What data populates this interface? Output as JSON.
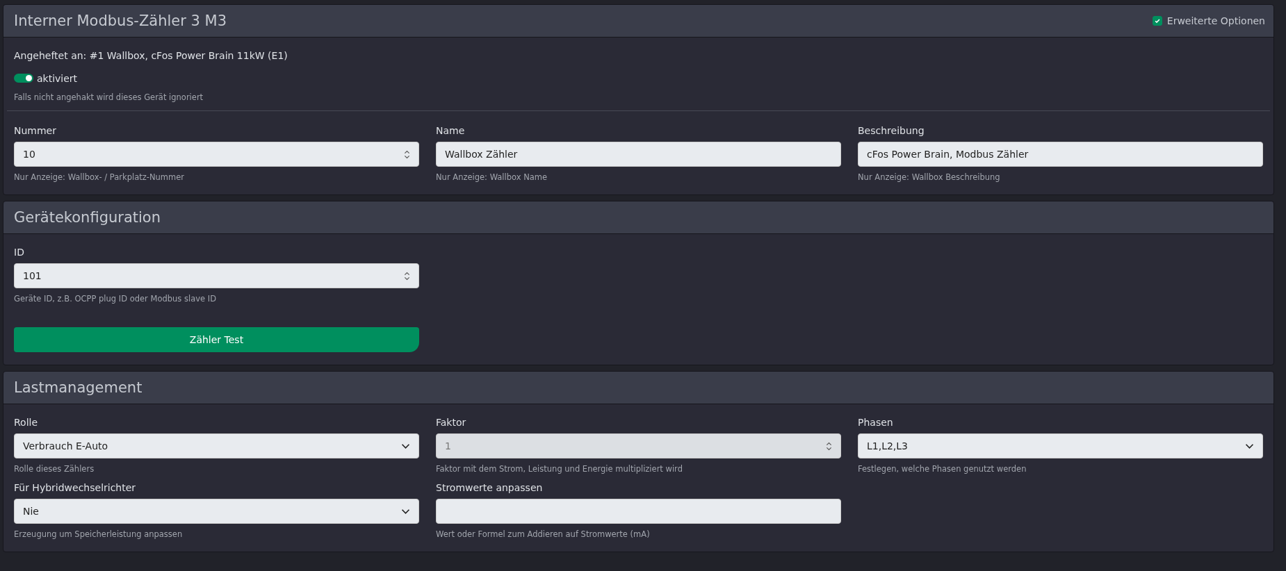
{
  "device_panel": {
    "title": "Interner Modbus-Zähler 3 M3",
    "advanced_option": {
      "label": "Erweiterte Optionen",
      "checked": true
    },
    "attached": "Angeheftet an: #1 Wallbox, cFos Power Brain 11kW (E1)",
    "enable_switch": {
      "label": "aktiviert",
      "on": true
    },
    "enable_help": "Falls nicht angehakt wird dieses Gerät ignoriert",
    "fields": [
      {
        "kind": "number",
        "label": "Nummer",
        "value": "10",
        "help": "Nur Anzeige: Wallbox- / Parkplatz-Nummer"
      },
      {
        "kind": "text",
        "label": "Name",
        "value": "Wallbox Zähler",
        "help": "Nur Anzeige: Wallbox Name"
      },
      {
        "kind": "text",
        "label": "Beschreibung",
        "value": "cFos Power Brain, Modbus Zähler",
        "help": "Nur Anzeige: Wallbox Beschreibung"
      }
    ]
  },
  "config_panel": {
    "title": "Gerätekonfiguration",
    "fields": [
      {
        "kind": "number",
        "label": "ID",
        "value": "101",
        "help": "Geräte ID, z.B. OCPP plug ID oder Modbus slave ID"
      }
    ],
    "button": "Zähler Test"
  },
  "load_panel": {
    "title": "Lastmanagement",
    "fields": [
      {
        "kind": "select",
        "label": "Rolle",
        "value": "Verbrauch E-Auto",
        "help": "Rolle dieses Zählers",
        "disabled": false
      },
      {
        "kind": "number",
        "label": "Faktor",
        "value": "1",
        "help": "Faktor mit dem Strom, Leistung und Energie multipliziert wird",
        "disabled": true
      },
      {
        "kind": "select",
        "label": "Phasen",
        "value": "L1,L2,L3",
        "help": "Festlegen, welche Phasen genutzt werden",
        "disabled": false
      },
      {
        "kind": "select",
        "label": "Für Hybridwechselrichter",
        "value": "Nie",
        "help": "Erzeugung um Speicherleistung anpassen",
        "disabled": false
      },
      {
        "kind": "text",
        "label": "Stromwerte anpassen",
        "help": "Wert oder Formel zum Addieren auf Stromwerte (mA)",
        "disabled": false
      }
    ]
  }
}
